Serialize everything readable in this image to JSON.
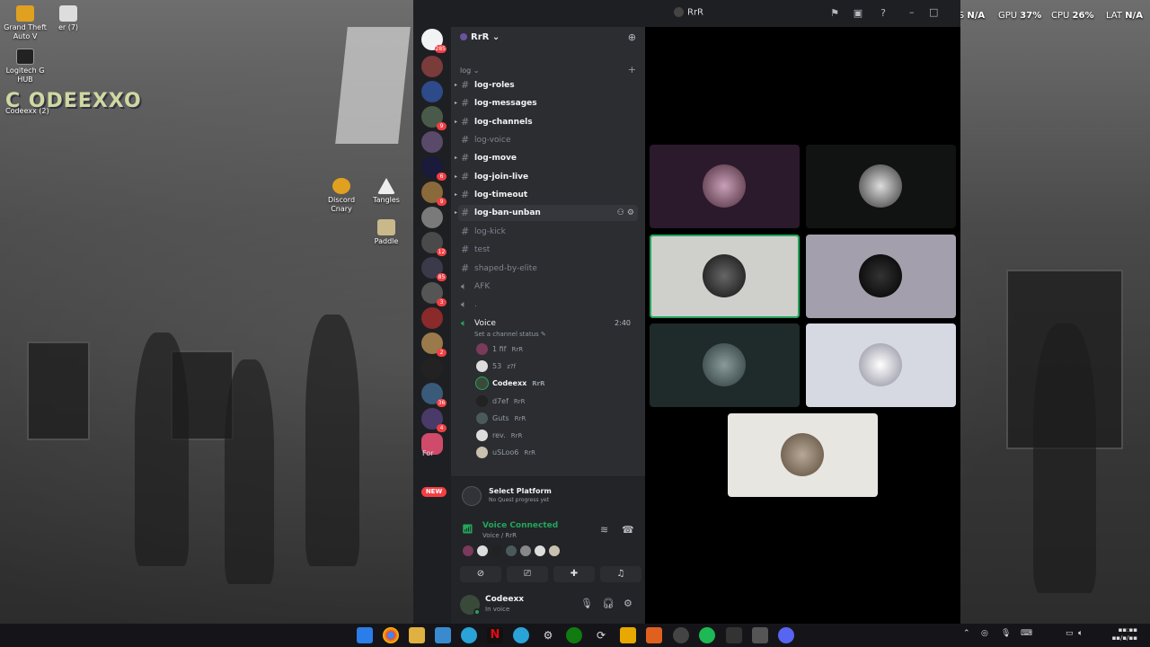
{
  "desktop": {
    "icons": [
      {
        "label": "Grand Theft Auto V",
        "name": "gta-v"
      },
      {
        "label": "er (7)",
        "name": "er-7"
      },
      {
        "label": "Logitech G HUB",
        "name": "logitech-g-hub"
      },
      {
        "label": "Discord Cnary",
        "name": "discord-canary"
      },
      {
        "label": "Tangles",
        "name": "tangles"
      },
      {
        "label": "Paddle",
        "name": "paddle"
      }
    ],
    "logo_text": "C  ODEEXXO",
    "logo_sub": "Codeexx (2)"
  },
  "overlay": {
    "fps_label": "FPS",
    "fps_value": "N/A",
    "gpu_label": "GPU",
    "gpu_value": "37",
    "cpu_label": "CPU",
    "cpu_value": "26",
    "lat_label": "LAT",
    "lat_value": "N/A"
  },
  "window": {
    "title": "RrR"
  },
  "guild_badges": [
    "285",
    "9",
    "6",
    "9",
    "12",
    "85",
    "3",
    "2",
    "36",
    "4"
  ],
  "guild_partial_label": "For",
  "new_badge": "NEW",
  "server": {
    "name": "RrR",
    "category": "log",
    "channels": [
      {
        "name": "log-roles",
        "unread": true
      },
      {
        "name": "log-messages",
        "unread": true
      },
      {
        "name": "log-channels",
        "unread": true
      },
      {
        "name": "log-voice",
        "unread": false
      },
      {
        "name": "log-move",
        "unread": true
      },
      {
        "name": "log-join-live",
        "unread": true
      },
      {
        "name": "log-timeout",
        "unread": true
      },
      {
        "name": "log-ban-unban",
        "unread": true
      },
      {
        "name": "log-kick",
        "unread": false
      },
      {
        "name": "test",
        "unread": false
      },
      {
        "name": "shaped-by-elite",
        "unread": false
      }
    ],
    "voice_channels": [
      {
        "name": "AFK"
      },
      {
        "name": "."
      }
    ],
    "active_voice": {
      "name": "Voice",
      "time": "2:40",
      "status": "Set a channel status",
      "members": [
        {
          "name": "1 fif",
          "activity": "RrR"
        },
        {
          "name": "53",
          "activity": "z?f"
        },
        {
          "name": "Codeexx",
          "activity": "RrR"
        },
        {
          "name": "d7ef",
          "activity": "RrR"
        },
        {
          "name": "Guts",
          "activity": "RrR"
        },
        {
          "name": "rev.",
          "activity": "RrR"
        },
        {
          "name": "uSLoo6",
          "activity": "RrR"
        }
      ]
    }
  },
  "quest": {
    "title": "Select Platform",
    "subtitle": "No Quest progress yet"
  },
  "rtc": {
    "title": "Voice Connected",
    "subtitle": "Voice / RrR"
  },
  "user": {
    "name": "Codeexx",
    "status": "In voice"
  },
  "colors": {
    "accent_green": "#23a55a",
    "danger_red": "#f23f43",
    "sidebar_bg": "#2b2d31",
    "guild_bg": "#1e1f22"
  },
  "icons": {
    "windows": "windows-icon",
    "chrome": "chrome-icon",
    "folder": "folder-icon",
    "store": "store-icon",
    "telegram": "telegram-icon",
    "netflix": "netflix-icon",
    "settings": "gear-icon",
    "xbox": "xbox-icon",
    "spotify": "spotify-icon",
    "discord": "discord-icon"
  }
}
